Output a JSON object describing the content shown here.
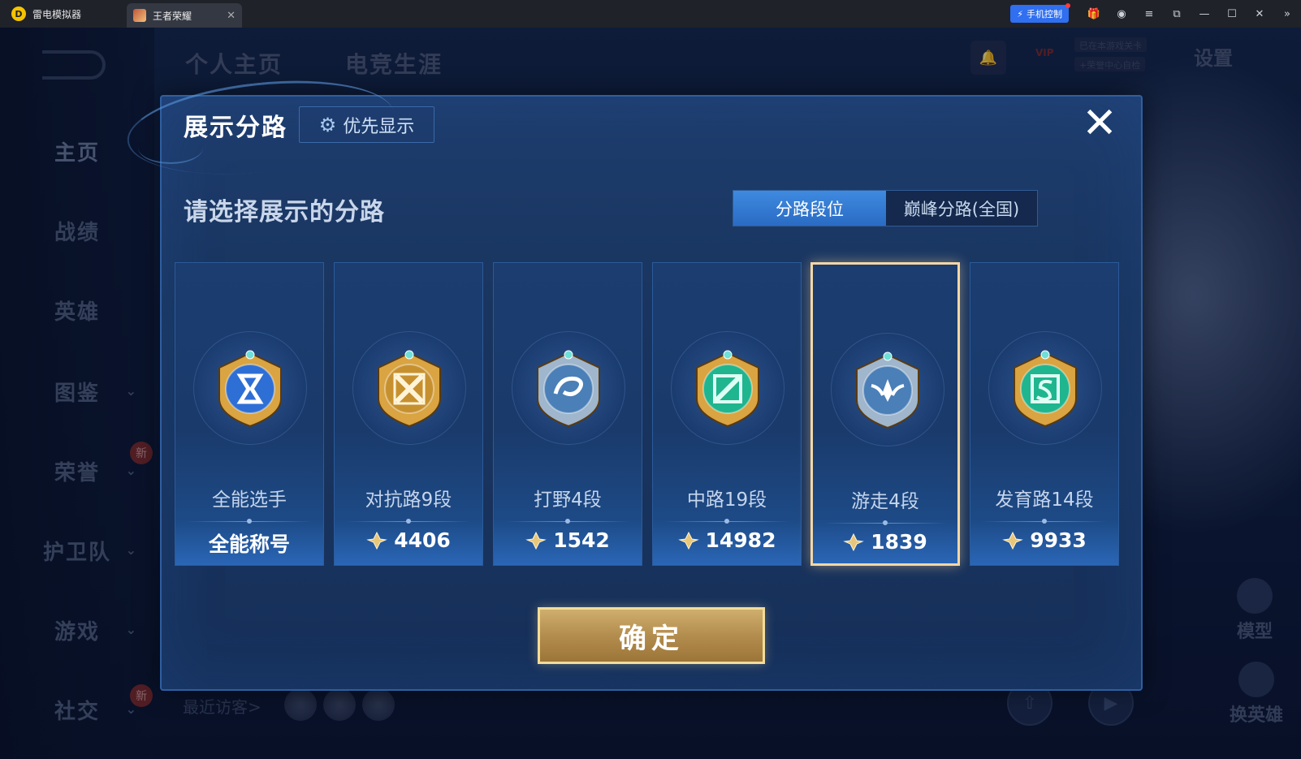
{
  "titlebar": {
    "app_name": "雷电模拟器",
    "game_tab_label": "王者荣耀",
    "phone_control_label": "手机控制"
  },
  "background": {
    "top_nav": [
      "个人主页",
      "电竞生涯"
    ],
    "sidebar_items": [
      {
        "label": "主页",
        "has_chevron": false,
        "new": false
      },
      {
        "label": "战绩",
        "has_chevron": false,
        "new": false
      },
      {
        "label": "英雄",
        "has_chevron": false,
        "new": false
      },
      {
        "label": "图鉴",
        "has_chevron": true,
        "new": false
      },
      {
        "label": "荣誉",
        "has_chevron": true,
        "new": true
      },
      {
        "label": "护卫队",
        "has_chevron": true,
        "new": false
      },
      {
        "label": "游戏",
        "has_chevron": true,
        "new": false
      },
      {
        "label": "社交",
        "has_chevron": true,
        "new": true
      }
    ],
    "new_badge": "新",
    "vip_label": "VIP",
    "notice_1": "已在本游戏关卡",
    "notice_2": "+荣誉中心自检",
    "settings_label": "设置",
    "recent_visitors": "最近访客>",
    "model_label": "模型",
    "switch_hero_label": "换英雄"
  },
  "dialog": {
    "title": "展示分路",
    "priority_button": "优先显示",
    "prompt": "请选择展示的分路",
    "tabs": [
      {
        "label": "分路段位",
        "active": true
      },
      {
        "label": "巅峰分路(全国)",
        "active": false
      }
    ],
    "cards": [
      {
        "name": "全能选手",
        "score": "全能称号",
        "has_point_icon": false,
        "badge": "all-rounder-badge-icon",
        "selected": false,
        "colors": [
          "#d9a441",
          "#2e6fd6"
        ]
      },
      {
        "name": "对抗路9段",
        "score": "4406",
        "has_point_icon": true,
        "badge": "clash-lane-badge-icon",
        "selected": false,
        "colors": [
          "#d9a441",
          "#c7902f"
        ]
      },
      {
        "name": "打野4段",
        "score": "1542",
        "has_point_icon": true,
        "badge": "jungle-badge-icon",
        "selected": false,
        "colors": [
          "#9fb6cc",
          "#4a7fb8"
        ]
      },
      {
        "name": "中路19段",
        "score": "14982",
        "has_point_icon": true,
        "badge": "mid-lane-badge-icon",
        "selected": false,
        "colors": [
          "#d9a441",
          "#1fb58f"
        ]
      },
      {
        "name": "游走4段",
        "score": "1839",
        "has_point_icon": true,
        "badge": "roam-badge-icon",
        "selected": true,
        "colors": [
          "#9fb6cc",
          "#4a7fb8"
        ]
      },
      {
        "name": "发育路14段",
        "score": "9933",
        "has_point_icon": true,
        "badge": "farm-lane-badge-icon",
        "selected": false,
        "colors": [
          "#d9a441",
          "#1fb58f"
        ]
      }
    ],
    "confirm_label": "确定"
  }
}
